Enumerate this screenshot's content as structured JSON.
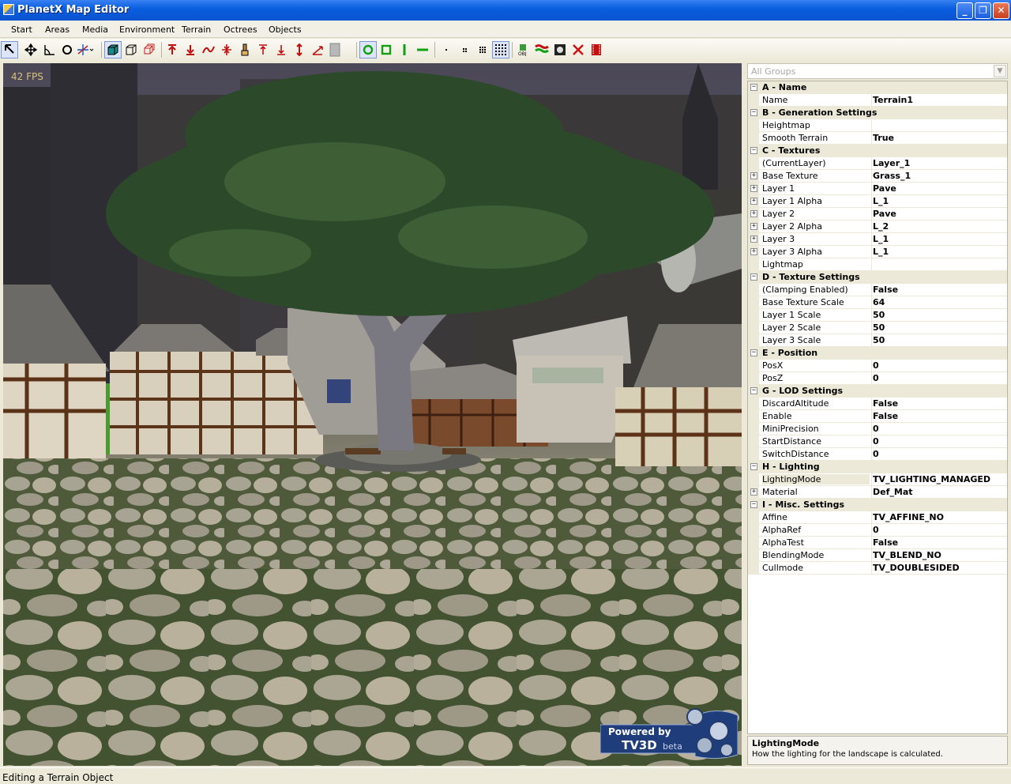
{
  "window": {
    "title": "PlanetX Map Editor"
  },
  "menu": [
    "Start",
    "Areas",
    "Media",
    "Environment",
    "Terrain",
    "Octrees",
    "Objects"
  ],
  "toolbar": {
    "icons": [
      "pointer-icon",
      "move-icon",
      "angle-icon",
      "rotate-icon",
      "axes-icon",
      "cube-solid-icon",
      "cube-wire-icon",
      "cube-copy-icon",
      "raise-icon",
      "lower-icon",
      "smooth-icon",
      "flatten-icon",
      "paint-icon",
      "raise-single-icon",
      "lower-single-icon",
      "height-icon",
      "slope-icon",
      "layers-icon",
      "circle-brush-icon",
      "square-brush-icon",
      "vertical-line-icon",
      "horizontal-line-icon",
      "brush-size-1-icon",
      "brush-size-2-icon",
      "brush-size-3-icon",
      "brush-size-4-icon",
      "export-obj-icon",
      "flag-icon",
      "preview-icon",
      "delete-icon",
      "film-icon"
    ]
  },
  "viewport": {
    "fps": "42 FPS",
    "badge_line1": "Powered by",
    "badge_line2": "TV3D",
    "badge_beta": "beta"
  },
  "properties": {
    "group_select": "All Groups",
    "groups": [
      {
        "title": "A - Name",
        "items": [
          {
            "name": "Name",
            "value": "Terrain1"
          }
        ]
      },
      {
        "title": "B - Generation Settings",
        "items": [
          {
            "name": "Heightmap",
            "value": ""
          },
          {
            "name": "Smooth Terrain",
            "value": "True"
          }
        ]
      },
      {
        "title": "C - Textures",
        "items": [
          {
            "name": "(CurrentLayer)",
            "value": "Layer_1"
          },
          {
            "name": "Base Texture",
            "value": "Grass_1",
            "expandable": true
          },
          {
            "name": "Layer 1",
            "value": "Pave",
            "expandable": true
          },
          {
            "name": "Layer 1 Alpha",
            "value": "L_1",
            "expandable": true
          },
          {
            "name": "Layer 2",
            "value": "Pave",
            "expandable": true
          },
          {
            "name": "Layer 2 Alpha",
            "value": "L_2",
            "expandable": true
          },
          {
            "name": "Layer 3",
            "value": "L_1",
            "expandable": true
          },
          {
            "name": "Layer 3 Alpha",
            "value": "L_1",
            "expandable": true
          },
          {
            "name": "Lightmap",
            "value": ""
          }
        ]
      },
      {
        "title": "D - Texture Settings",
        "items": [
          {
            "name": "(Clamping Enabled)",
            "value": "False"
          },
          {
            "name": "Base Texture Scale",
            "value": "64"
          },
          {
            "name": "Layer 1 Scale",
            "value": "50"
          },
          {
            "name": "Layer 2 Scale",
            "value": "50"
          },
          {
            "name": "Layer 3 Scale",
            "value": "50"
          }
        ]
      },
      {
        "title": "E - Position",
        "items": [
          {
            "name": "PosX",
            "value": "0"
          },
          {
            "name": "PosZ",
            "value": "0"
          }
        ]
      },
      {
        "title": "G - LOD Settings",
        "items": [
          {
            "name": "DiscardAltitude",
            "value": "False"
          },
          {
            "name": "Enable",
            "value": "False"
          },
          {
            "name": "MiniPrecision",
            "value": "0"
          },
          {
            "name": "StartDistance",
            "value": "0"
          },
          {
            "name": "SwitchDistance",
            "value": "0"
          }
        ]
      },
      {
        "title": "H - Lighting",
        "items": [
          {
            "name": "LightingMode",
            "value": "TV_LIGHTING_MANAGED",
            "selected": true
          },
          {
            "name": "Material",
            "value": "Def_Mat",
            "expandable": true
          }
        ]
      },
      {
        "title": "I - Misc. Settings",
        "items": [
          {
            "name": "Affine",
            "value": "TV_AFFINE_NO"
          },
          {
            "name": "AlphaRef",
            "value": "0"
          },
          {
            "name": "AlphaTest",
            "value": "False"
          },
          {
            "name": "BlendingMode",
            "value": "TV_BLEND_NO"
          },
          {
            "name": "Cullmode",
            "value": "TV_DOUBLESIDED"
          }
        ]
      }
    ],
    "description": {
      "title": "LightingMode",
      "text": "How the lighting for the landscape is calculated."
    }
  },
  "status": {
    "text": "Editing a Terrain Object"
  },
  "colors": {
    "titlebar": "#0b5ce0",
    "panel": "#ece9d8",
    "fps": "#d9c07a"
  }
}
